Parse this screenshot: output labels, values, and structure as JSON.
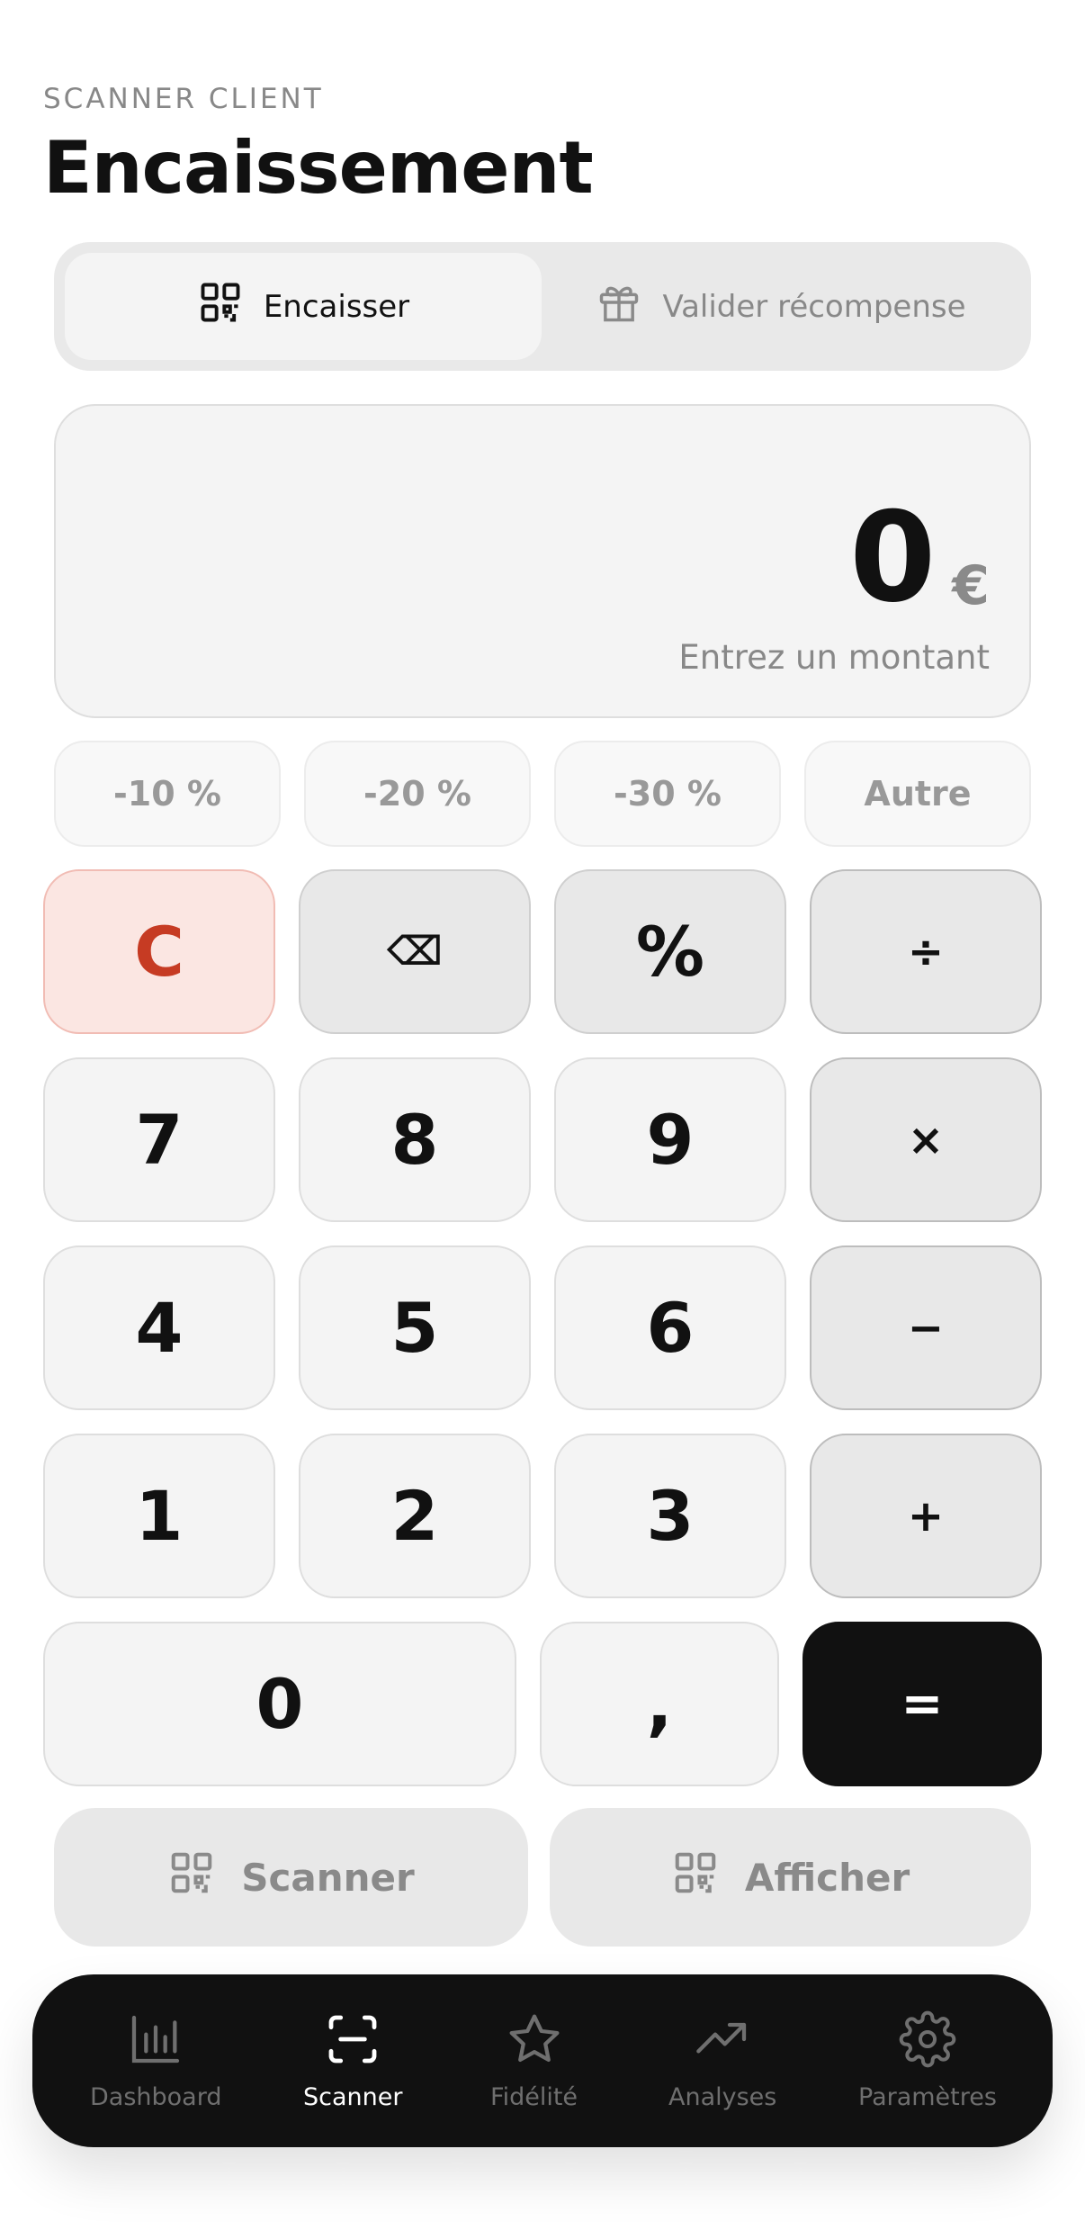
{
  "header": {
    "eyebrow": "SCANNER CLIENT",
    "title": "Encaissement"
  },
  "segmented": {
    "active_label": "Encaisser",
    "active_icon": "qr-code-icon",
    "inactive_label": "Valider récompense",
    "inactive_icon": "gift-icon"
  },
  "display": {
    "amount": "0",
    "currency": "€",
    "hint": "Entrez un montant"
  },
  "discounts": [
    "-10 %",
    "-20 %",
    "-30 %",
    "Autre"
  ],
  "keypad": {
    "clear": "C",
    "backspace": "⌫",
    "percent": "%",
    "divide": "÷",
    "multiply": "×",
    "minus": "−",
    "plus": "+",
    "equals": "=",
    "comma": ",",
    "k7": "7",
    "k8": "8",
    "k9": "9",
    "k4": "4",
    "k5": "5",
    "k6": "6",
    "k1": "1",
    "k2": "2",
    "k3": "3",
    "k0": "0"
  },
  "actions": {
    "scanner": "Scanner",
    "afficher": "Afficher"
  },
  "tabs": [
    {
      "label": "Dashboard",
      "icon": "bar-chart-icon"
    },
    {
      "label": "Scanner",
      "icon": "scan-icon"
    },
    {
      "label": "Fidélité",
      "icon": "star-icon"
    },
    {
      "label": "Analyses",
      "icon": "trending-up-icon"
    },
    {
      "label": "Paramètres",
      "icon": "gear-icon"
    }
  ],
  "colors": {
    "accent_dark": "#111111",
    "clear_red": "#c63b23",
    "clear_bg": "#fbe6e2"
  }
}
